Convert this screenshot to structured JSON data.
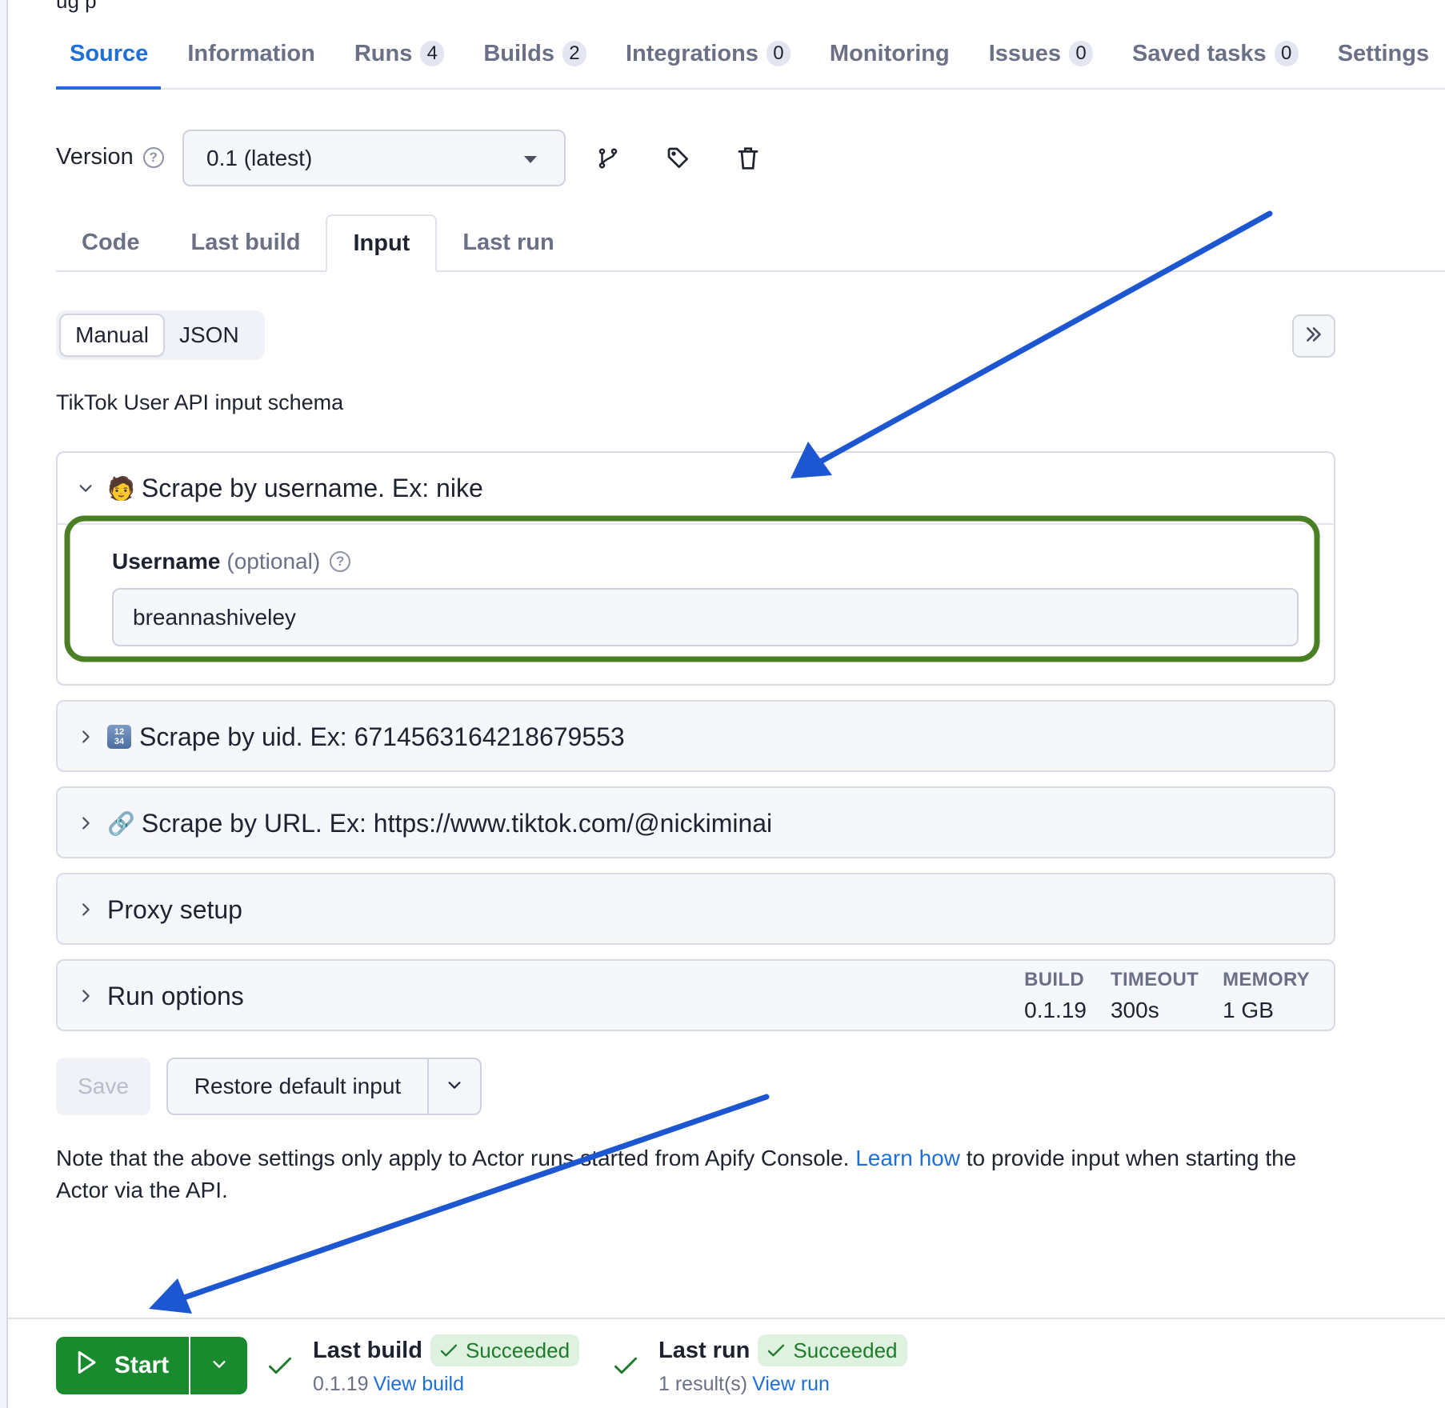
{
  "page": {
    "cut_off_header_text": "ug p"
  },
  "main_tabs": [
    {
      "label": "Source",
      "active": true
    },
    {
      "label": "Information"
    },
    {
      "label": "Runs",
      "badge": "4"
    },
    {
      "label": "Builds",
      "badge": "2"
    },
    {
      "label": "Integrations",
      "badge": "0"
    },
    {
      "label": "Monitoring"
    },
    {
      "label": "Issues",
      "badge": "0"
    },
    {
      "label": "Saved tasks",
      "badge": "0"
    },
    {
      "label": "Settings"
    }
  ],
  "version": {
    "label": "Version",
    "help_icon": "question-circle-icon",
    "selected": "0.1 (latest)",
    "actions": [
      {
        "icon": "git-branch-icon"
      },
      {
        "icon": "tag-icon"
      },
      {
        "icon": "trash-icon"
      }
    ]
  },
  "sub_tabs": [
    {
      "label": "Code"
    },
    {
      "label": "Last build"
    },
    {
      "label": "Input",
      "active": true
    },
    {
      "label": "Last run"
    }
  ],
  "input_mode": {
    "options": [
      "Manual",
      "JSON"
    ],
    "selected": "Manual",
    "expand_icon": "chevrons-right-icon"
  },
  "schema_title": "TikTok User API input schema",
  "sections": {
    "username": {
      "emoji": "🧑",
      "title": "Scrape by username. Ex: nike",
      "expanded": true,
      "field_label": "Username",
      "field_optional": "(optional)",
      "field_value": "breannashiveley"
    },
    "uid": {
      "emoji_top": "12",
      "emoji_bottom": "34",
      "title": "Scrape by uid. Ex: 6714563164218679553",
      "expanded": false
    },
    "url": {
      "emoji": "🔗",
      "title": "Scrape by URL. Ex: https://www.tiktok.com/@nickiminai",
      "expanded": false
    },
    "proxy": {
      "title": "Proxy setup",
      "expanded": false
    },
    "run_options": {
      "title": "Run options",
      "expanded": false,
      "stats": [
        {
          "label": "BUILD",
          "value": "0.1.19"
        },
        {
          "label": "TIMEOUT",
          "value": "300s"
        },
        {
          "label": "MEMORY",
          "value": "1 GB"
        }
      ]
    }
  },
  "actions": {
    "save_label": "Save",
    "save_disabled": true,
    "restore_label": "Restore default input"
  },
  "note": {
    "before": "Note that the above settings only apply to Actor runs started from Apify Console. ",
    "link": "Learn how",
    "after": " to provide input when starting the Actor via the API."
  },
  "footer": {
    "start_label": "Start",
    "last_build": {
      "label": "Last build",
      "status": "Succeeded",
      "version": "0.1.19",
      "link": "View build"
    },
    "last_run": {
      "label": "Last run",
      "status": "Succeeded",
      "results": "1 result(s)",
      "link": "View run"
    }
  },
  "colors": {
    "accent_blue": "#1f6fd6",
    "start_green": "#1a8a2f",
    "success_bg": "#dff1df",
    "success_text": "#1e7b2c",
    "annotation_arrow": "#1d56d1",
    "annotation_highlight": "#4a7f23"
  }
}
